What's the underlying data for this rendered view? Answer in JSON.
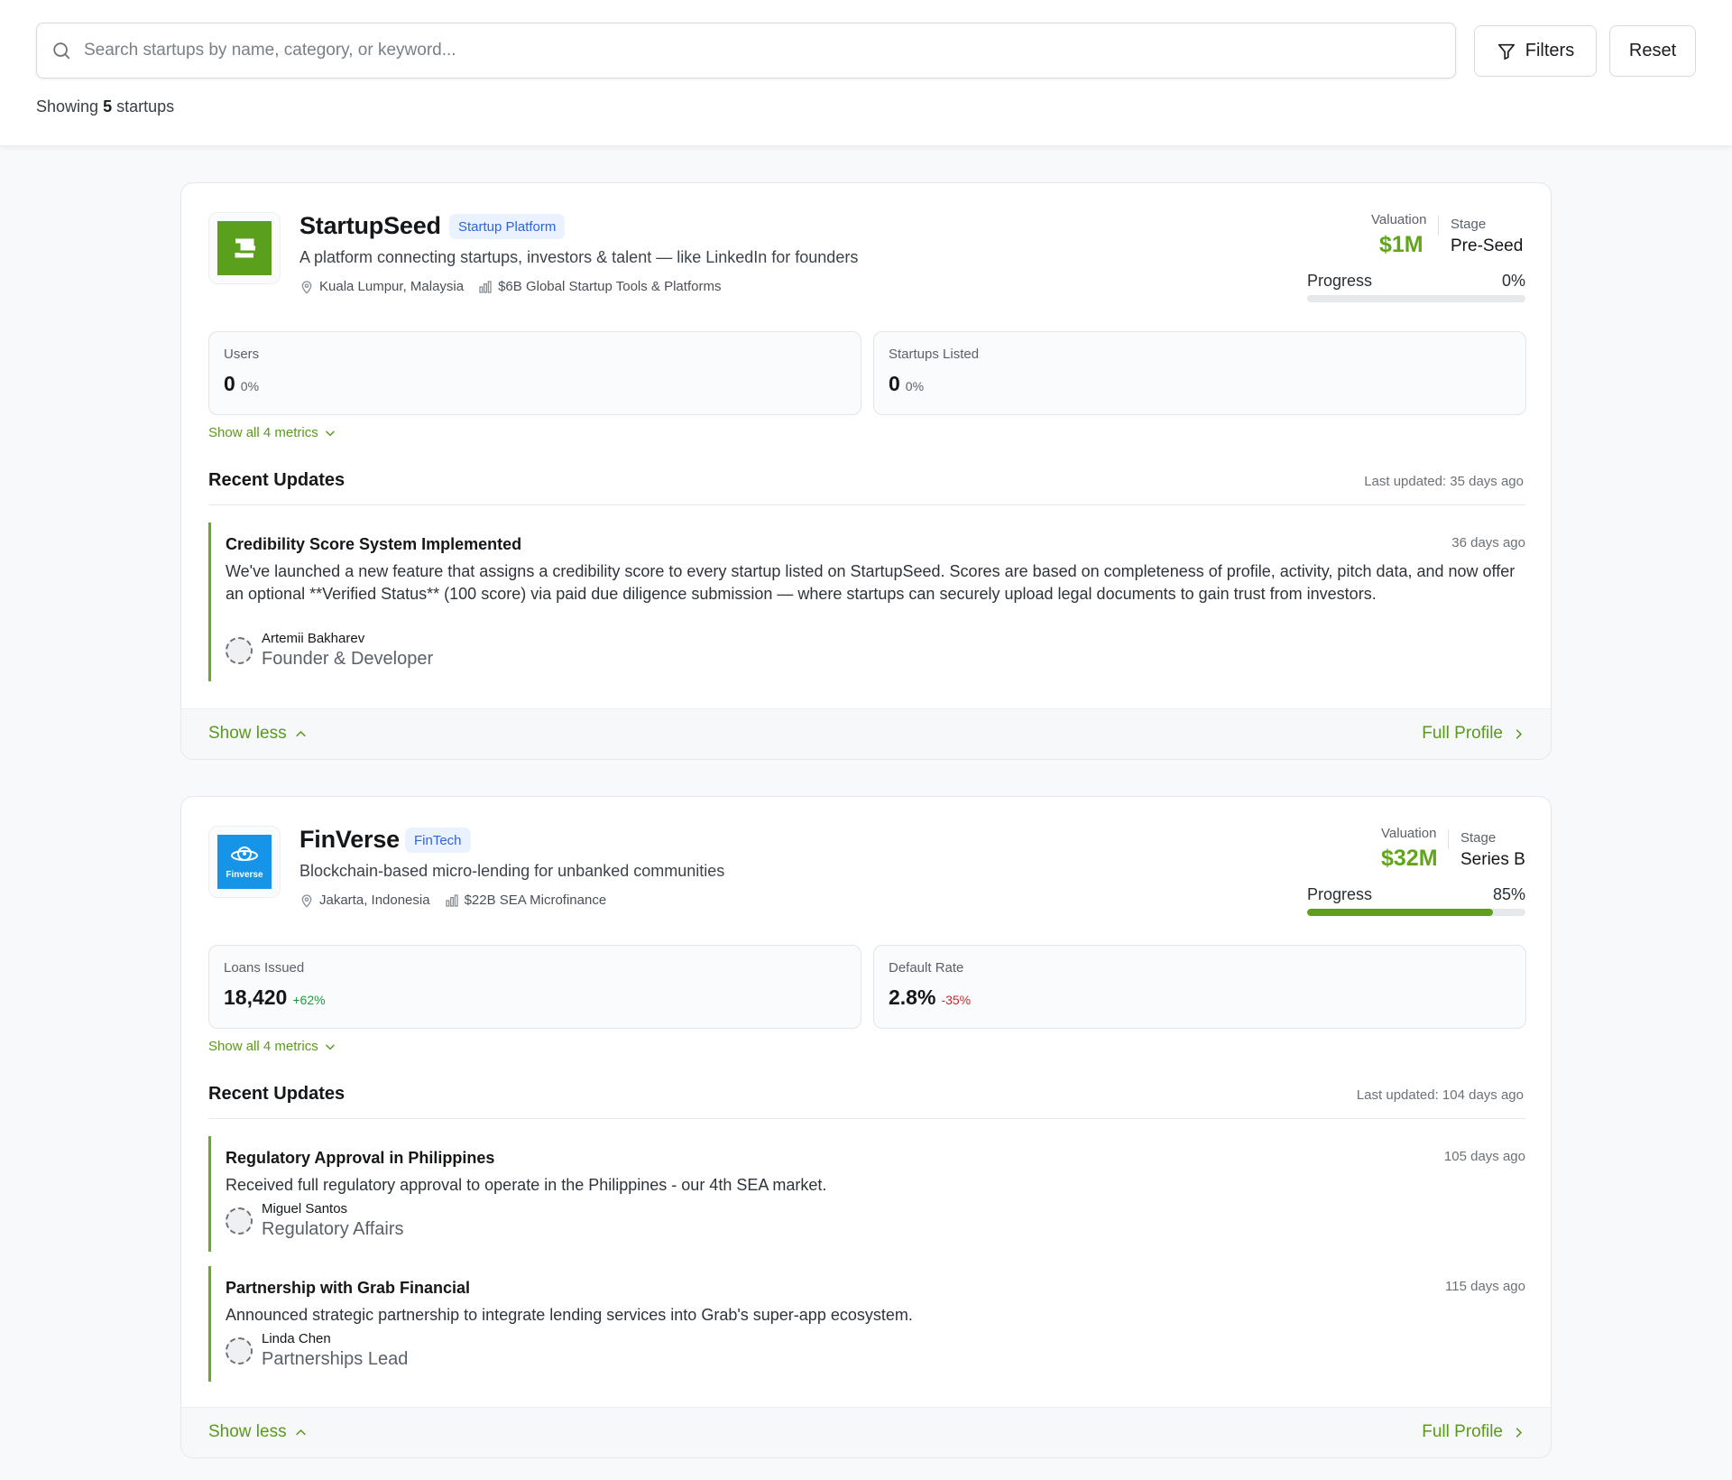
{
  "search": {
    "placeholder": "Search startups by name, category, or keyword...",
    "filters_label": "Filters",
    "reset_label": "Reset",
    "count_prefix": "Showing",
    "count": "5",
    "count_suffix": "startups"
  },
  "colors": {
    "accent": "#61a61a",
    "tag_bg": "#ebf2ff",
    "tag_text": "#2f64d8",
    "positive": "#1f9d3a",
    "negative": "#d32727"
  },
  "startups": [
    {
      "name": "StartupSeed",
      "tag": "Startup Platform",
      "tagline": "A platform connecting startups, investors & talent — like LinkedIn for founders",
      "location": "Kuala Lumpur, Malaysia",
      "market": "$6B Global Startup Tools & Platforms",
      "valuation_label": "Valuation",
      "valuation": "$1M",
      "stage_label": "Stage",
      "stage": "Pre-Seed",
      "progress_label": "Progress",
      "progress": "0%",
      "progress_fraction": 0,
      "metrics": [
        {
          "label": "Users",
          "value": "0",
          "change": "0%",
          "trend": "neutral"
        },
        {
          "label": "Startups Listed",
          "value": "0",
          "change": "0%",
          "trend": "neutral"
        }
      ],
      "show_metrics_label": "Show all 4 metrics",
      "recent_updates_title": "Recent Updates",
      "last_updated": "Last updated: 35 days ago",
      "updates": [
        {
          "title": "Credibility Score System Implemented",
          "time": "36 days ago",
          "body": "We've launched a new feature that assigns a credibility score to every startup listed on StartupSeed. Scores are based on completeness of profile, activity, pitch data, and now offer an optional **Verified Status** (100 score) via paid due diligence submission — where startups can securely upload legal documents to gain trust from investors.",
          "author": "Artemii Bakharev",
          "role": "Founder & Developer"
        }
      ],
      "show_less_label": "Show less",
      "full_profile_label": "Full Profile"
    },
    {
      "name": "FinVerse",
      "tag": "FinTech",
      "logo_text": "Finverse",
      "tagline": "Blockchain-based micro-lending for unbanked communities",
      "location": "Jakarta, Indonesia",
      "market": "$22B SEA Microfinance",
      "valuation_label": "Valuation",
      "valuation": "$32M",
      "stage_label": "Stage",
      "stage": "Series B",
      "progress_label": "Progress",
      "progress": "85%",
      "progress_fraction": 0.85,
      "metrics": [
        {
          "label": "Loans Issued",
          "value": "18,420",
          "change": "+62%",
          "trend": "pos"
        },
        {
          "label": "Default Rate",
          "value": "2.8%",
          "change": "-35%",
          "trend": "neg"
        }
      ],
      "show_metrics_label": "Show all 4 metrics",
      "recent_updates_title": "Recent Updates",
      "last_updated": "Last updated: 104 days ago",
      "updates": [
        {
          "title": "Regulatory Approval in Philippines",
          "time": "105 days ago",
          "body": "Received full regulatory approval to operate in the Philippines - our 4th SEA market.",
          "author": "Miguel Santos",
          "role": "Regulatory Affairs"
        },
        {
          "title": "Partnership with Grab Financial",
          "time": "115 days ago",
          "body": "Announced strategic partnership to integrate lending services into Grab's super-app ecosystem.",
          "author": "Linda Chen",
          "role": "Partnerships Lead"
        }
      ],
      "show_less_label": "Show less",
      "full_profile_label": "Full Profile"
    }
  ]
}
